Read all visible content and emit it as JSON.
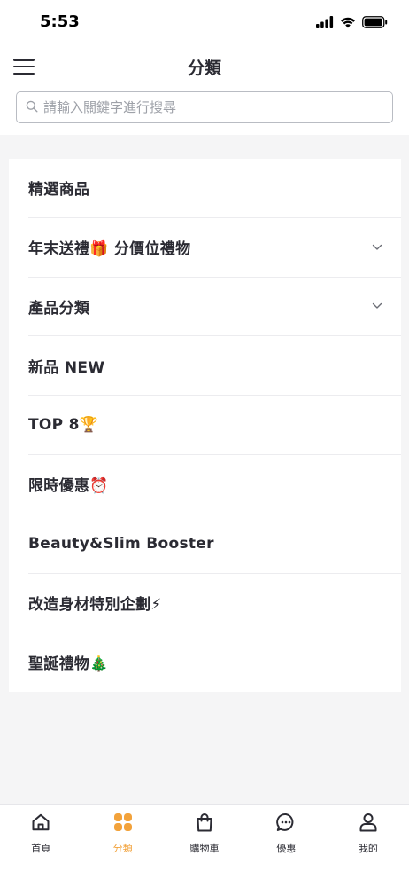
{
  "status_bar": {
    "time": "5:53"
  },
  "header": {
    "title": "分類"
  },
  "search": {
    "placeholder": "請輸入關鍵字進行搜尋"
  },
  "categories": [
    {
      "label": "精選商品",
      "has_children": false
    },
    {
      "label": "年末送禮🎁 分價位禮物",
      "has_children": true
    },
    {
      "label": "產品分類",
      "has_children": true
    },
    {
      "label": "新品 NEW",
      "has_children": false
    },
    {
      "label": "TOP 8🏆",
      "has_children": false
    },
    {
      "label": "限時優惠⏰",
      "has_children": false
    },
    {
      "label": "Beauty&Slim Booster",
      "has_children": false
    },
    {
      "label": "改造身材特別企劃⚡",
      "has_children": false
    },
    {
      "label": "聖誕禮物🎄",
      "has_children": false
    }
  ],
  "tab_bar": {
    "active": "category",
    "accent_color": "#f2a23b",
    "tabs": [
      {
        "id": "home",
        "label": "首頁",
        "icon": "home-icon"
      },
      {
        "id": "category",
        "label": "分類",
        "icon": "grid-icon"
      },
      {
        "id": "cart",
        "label": "購物車",
        "icon": "shopping-bag-icon"
      },
      {
        "id": "offers",
        "label": "優惠",
        "icon": "chat-bubble-icon"
      },
      {
        "id": "account",
        "label": "我的",
        "icon": "user-icon"
      }
    ]
  }
}
